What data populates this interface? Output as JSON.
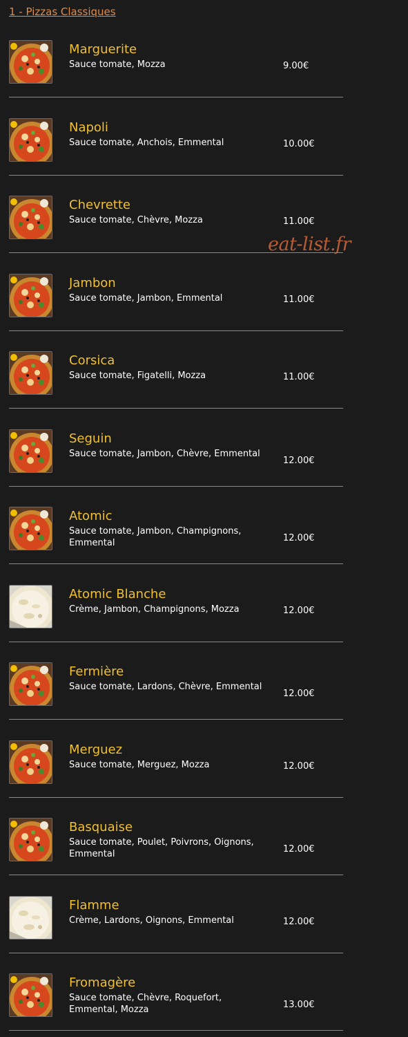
{
  "section": {
    "title": "1 - Pizzas Classiques"
  },
  "watermark": "eat-list.fr",
  "items": [
    {
      "name": "Marguerite",
      "description": "Sauce tomate, Mozza",
      "price": "9.00€",
      "image": "tomato-pizza"
    },
    {
      "name": "Napoli",
      "description": "Sauce tomate, Anchois, Emmental",
      "price": "10.00€",
      "image": "tomato-pizza"
    },
    {
      "name": "Chevrette",
      "description": "Sauce tomate, Chèvre, Mozza",
      "price": "11.00€",
      "image": "tomato-pizza"
    },
    {
      "name": "Jambon",
      "description": "Sauce tomate, Jambon, Emmental",
      "price": "11.00€",
      "image": "tomato-pizza"
    },
    {
      "name": "Corsica",
      "description": "Sauce tomate, Figatelli, Mozza",
      "price": "11.00€",
      "image": "tomato-pizza"
    },
    {
      "name": "Seguin",
      "description": "Sauce tomate, Jambon, Chèvre, Emmental",
      "price": "12.00€",
      "image": "tomato-pizza"
    },
    {
      "name": "Atomic",
      "description": "Sauce tomate, Jambon, Champignons, Emmental",
      "price": "12.00€",
      "image": "tomato-pizza"
    },
    {
      "name": "Atomic Blanche",
      "description": "Crème, Jambon, Champignons, Mozza",
      "price": "12.00€",
      "image": "cream-pizza"
    },
    {
      "name": "Fermière",
      "description": "Sauce tomate, Lardons, Chèvre, Emmental",
      "price": "12.00€",
      "image": "tomato-pizza"
    },
    {
      "name": "Merguez",
      "description": "Sauce tomate, Merguez, Mozza",
      "price": "12.00€",
      "image": "tomato-pizza"
    },
    {
      "name": "Basquaise",
      "description": "Sauce tomate, Poulet, Poivrons, Oignons, Emmental",
      "price": "12.00€",
      "image": "tomato-pizza"
    },
    {
      "name": "Flamme",
      "description": "Crème, Lardons, Oignons, Emmental",
      "price": "12.00€",
      "image": "cream-pizza"
    },
    {
      "name": "Fromagère",
      "description": "Sauce tomate, Chèvre, Roquefort, Emmental, Mozza",
      "price": "13.00€",
      "image": "tomato-pizza"
    }
  ]
}
